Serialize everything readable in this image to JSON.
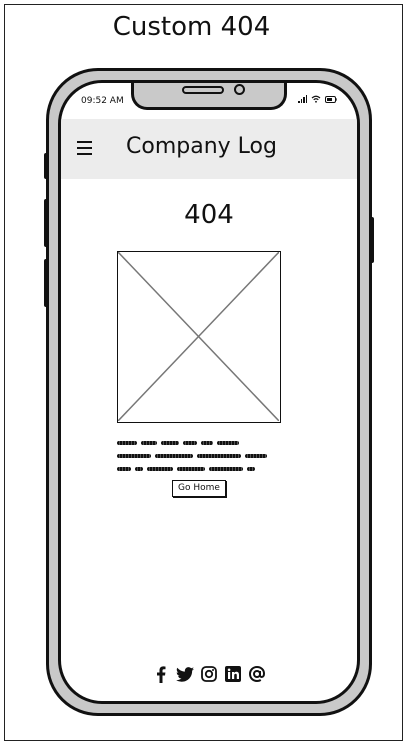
{
  "page": {
    "title": "Custom 404"
  },
  "device": {
    "status_time": "09:52 AM"
  },
  "header": {
    "menu_icon": "hamburger-menu-icon",
    "title": "Company Log"
  },
  "main": {
    "error_code": "404",
    "image_placeholder": "image-placeholder-icon",
    "button_label": "Go Home"
  },
  "footer": {
    "social_icons": [
      "facebook-icon",
      "twitter-icon",
      "instagram-icon",
      "linkedin-icon",
      "email-icon"
    ]
  },
  "colors": {
    "header_bg": "#ececec",
    "phone_body": "#c9c9c9",
    "ink": "#111111"
  }
}
